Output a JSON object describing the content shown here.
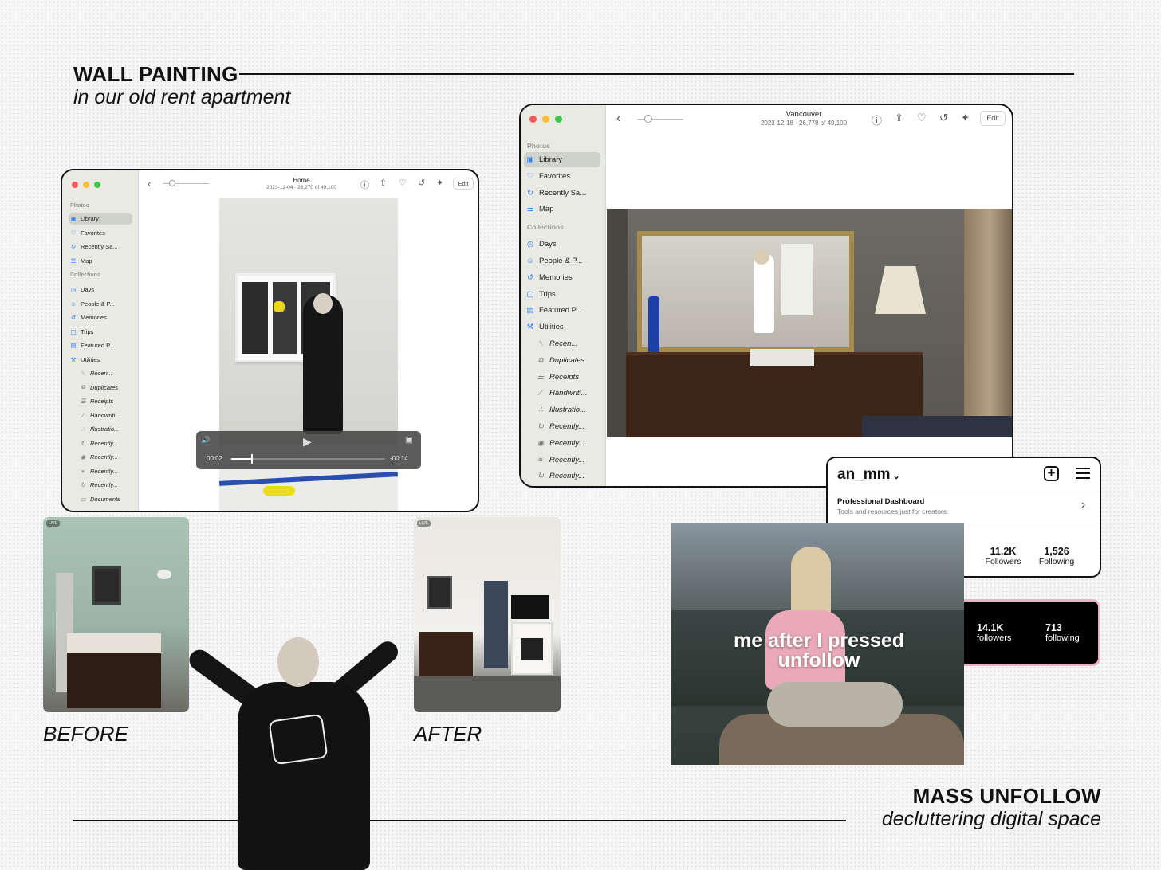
{
  "top_section": {
    "title": "WALL PAINTING",
    "subtitle": "in our old rent apartment"
  },
  "bottom_section": {
    "title": "MASS UNFOLLOW",
    "subtitle": "decluttering digital space"
  },
  "before_label": "BEFORE",
  "after_label": "AFTER",
  "live_badge": "LIVE",
  "window_left": {
    "title": "Home",
    "meta": "2023-12-04 · 26,270 of 49,100",
    "edit": "Edit",
    "video": {
      "elapsed": "00:02",
      "remaining": "-00:14",
      "progress": 0.13
    },
    "sidebar": {
      "photos_header": "Photos",
      "photos": [
        "Library",
        "Favorites",
        "Recently Sa...",
        "Map"
      ],
      "collections_header": "Collections",
      "collections": [
        "Days",
        "People & P...",
        "Memories",
        "Trips",
        "Featured P...",
        "Utilities"
      ],
      "utilities": [
        "Recen...",
        "Duplicates",
        "Receipts",
        "Handwriti...",
        "Illustratio...",
        "Recently...",
        "Recently...",
        "Recently...",
        "Recently...",
        "Documents"
      ]
    }
  },
  "window_right": {
    "title": "Vancouver",
    "meta": "2023-12-18 · 26,778 of 49,100",
    "edit": "Edit",
    "sidebar": {
      "photos_header": "Photos",
      "photos": [
        "Library",
        "Favorites",
        "Recently Sa...",
        "Map"
      ],
      "collections_header": "Collections",
      "collections": [
        "Days",
        "People & P...",
        "Memories",
        "Trips",
        "Featured P...",
        "Utilities"
      ],
      "utilities": [
        "Recen...",
        "Duplicates",
        "Receipts",
        "Handwriti...",
        "Illustratio...",
        "Recently...",
        "Recently...",
        "Recently...",
        "Recently..."
      ]
    }
  },
  "ig_card": {
    "username": "an_mm",
    "dashboard_title": "Professional Dashboard",
    "dashboard_sub": "Tools and resources just for creators.",
    "followers_count": "11.2K",
    "followers_label": "Followers",
    "following_count": "1,526",
    "following_label": "Following"
  },
  "ig_dark": {
    "followers_count": "14.1K",
    "followers_label": "followers",
    "following_count": "713",
    "following_label": "following"
  },
  "meme_caption": "me after I pressed unfollow",
  "colors": {
    "accent_blue": "#2d7cf6",
    "pink_border": "#e9b3c2"
  }
}
